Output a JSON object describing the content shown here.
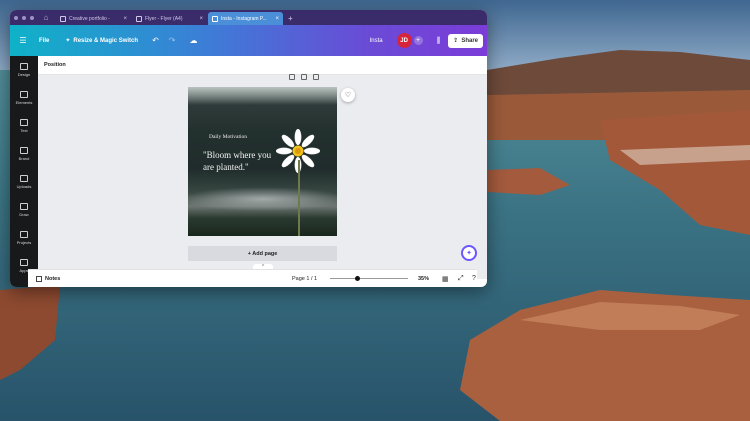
{
  "browser": {
    "tabs": [
      {
        "title": "Creative portfolio -"
      },
      {
        "title": "Flyer - Flyer (A4)"
      },
      {
        "title": "Insta - Instagram P..."
      }
    ],
    "active_tab": 2
  },
  "toolbar": {
    "file_label": "File",
    "resize_label": "Resize & Magic Switch",
    "doc_title": "Insta",
    "avatar_initials": "JD",
    "share_label": "Share"
  },
  "sidebar": {
    "items": [
      {
        "label": "Design"
      },
      {
        "label": "Elements"
      },
      {
        "label": "Text"
      },
      {
        "label": "Brand"
      },
      {
        "label": "Uploads"
      },
      {
        "label": "Draw"
      },
      {
        "label": "Projects"
      },
      {
        "label": "Apps"
      }
    ]
  },
  "context_bar": {
    "label": "Position"
  },
  "design": {
    "subtitle": "Daily Motivation",
    "quote": "\"Bloom where you are planted.\""
  },
  "add_page_label": "+ Add page",
  "footer": {
    "notes_label": "Notes",
    "page_indicator": "Page 1 / 1",
    "zoom_label": "35%",
    "zoom_fraction": 0.35
  },
  "colors": {
    "toolbar_start": "#0fb2c8",
    "toolbar_end": "#7b3cd8",
    "avatar": "#d6243a",
    "tabbar": "#3a2c6a"
  }
}
